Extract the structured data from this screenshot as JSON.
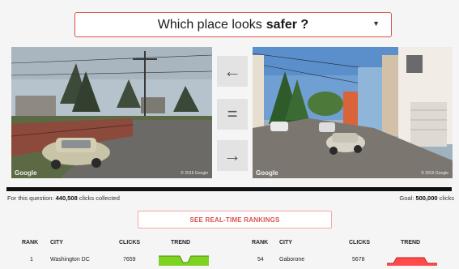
{
  "question": {
    "text": "Which place looks",
    "emphasis": "safer ?",
    "dropdown_icon": "caret-down-icon"
  },
  "photos": {
    "left": {
      "watermark": "Google",
      "copyright": "© 2016 Google"
    },
    "right": {
      "watermark": "Google",
      "copyright": "© 2016 Google"
    }
  },
  "vote_buttons": {
    "left": {
      "icon": "arrow-left-icon",
      "glyph": "←"
    },
    "equal": {
      "icon": "equal-icon",
      "glyph": "="
    },
    "right": {
      "icon": "arrow-right-icon",
      "glyph": "→"
    }
  },
  "progress": {
    "prefix": "For this question:",
    "clicks": "440,508",
    "suffix": "clicks collected",
    "goal_prefix": "Goal:",
    "goal": "500,000",
    "goal_suffix": "clicks",
    "fraction": 0.88
  },
  "rankings_button": "SEE REAL-TIME RANKINGS",
  "table": {
    "headers": {
      "rank": "RANK",
      "city": "CITY",
      "clicks": "CLICKS",
      "trend": "TREND"
    },
    "left_row": {
      "rank": "1",
      "city": "Washington DC",
      "clicks": "7659",
      "trend_color": "#7ed321"
    },
    "right_row": {
      "rank": "54",
      "city": "Gaborone",
      "clicks": "5678",
      "trend_color": "#ff4b4b"
    }
  }
}
